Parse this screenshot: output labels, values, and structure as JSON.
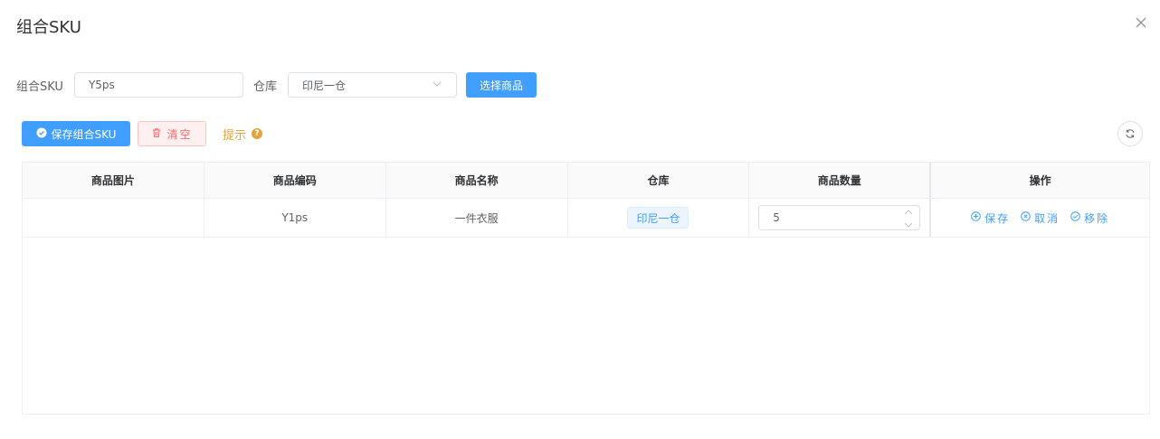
{
  "dialog": {
    "title": "组合SKU"
  },
  "form": {
    "sku_label": "组合SKU",
    "sku_value": "Y5ps",
    "warehouse_label": "仓库",
    "warehouse_value": "印尼一仓",
    "select_product_label": "选择商品"
  },
  "toolbar": {
    "save_label": "保存组合SKU",
    "clear_label": "清空",
    "hint_label": "提示"
  },
  "table": {
    "columns": [
      "商品图片",
      "商品编码",
      "商品名称",
      "仓库",
      "商品数量",
      "操作"
    ],
    "rows": [
      {
        "image": "",
        "code": "Y1ps",
        "name": "一件衣服",
        "warehouse": "印尼一仓",
        "quantity": "5",
        "actions": [
          "保存",
          "取消",
          "移除"
        ]
      }
    ]
  },
  "colors": {
    "primary": "#409eff",
    "danger": "#f56c6c",
    "warning": "#e6a23c"
  }
}
